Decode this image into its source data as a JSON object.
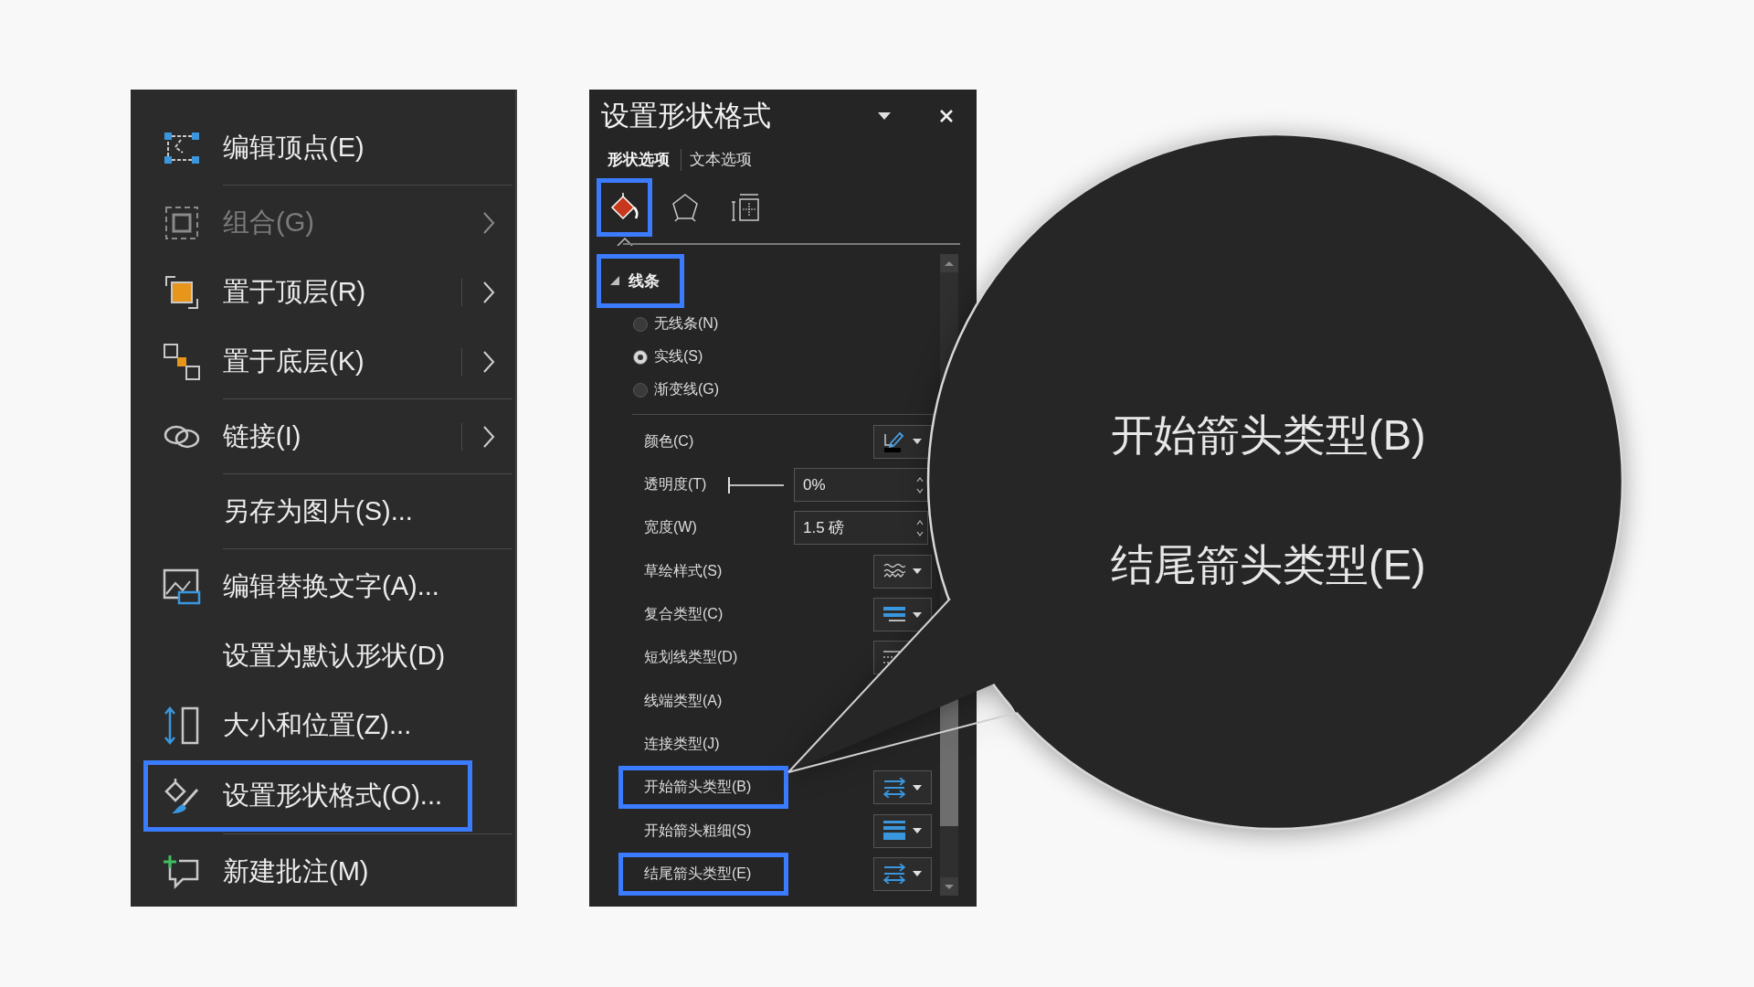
{
  "context_menu": {
    "items": [
      {
        "kind": "vertex",
        "label": "编辑顶点(E)",
        "submenu": false,
        "disabled": false,
        "highlighted": false
      },
      {
        "kind": "separator"
      },
      {
        "kind": "group",
        "label": "组合(G)",
        "submenu": true,
        "disabled": true,
        "highlighted": false
      },
      {
        "kind": "front",
        "label": "置于顶层(R)",
        "submenu": true,
        "disabled": false,
        "highlighted": false
      },
      {
        "kind": "back",
        "label": "置于底层(K)",
        "submenu": true,
        "disabled": false,
        "highlighted": false
      },
      {
        "kind": "separator"
      },
      {
        "kind": "link",
        "label": "链接(I)",
        "submenu": true,
        "disabled": false,
        "highlighted": false
      },
      {
        "kind": "separator"
      },
      {
        "kind": "plain",
        "label": "另存为图片(S)...",
        "submenu": false,
        "disabled": false,
        "highlighted": false
      },
      {
        "kind": "separator"
      },
      {
        "kind": "alt",
        "label": "编辑替换文字(A)...",
        "submenu": false,
        "disabled": false,
        "highlighted": false
      },
      {
        "kind": "plain",
        "label": "设置为默认形状(D)",
        "submenu": false,
        "disabled": false,
        "highlighted": false
      },
      {
        "kind": "size",
        "label": "大小和位置(Z)...",
        "submenu": false,
        "disabled": false,
        "highlighted": false
      },
      {
        "kind": "format",
        "label": "设置形状格式(O)...",
        "submenu": false,
        "disabled": false,
        "highlighted": true
      },
      {
        "kind": "separator"
      },
      {
        "kind": "comment",
        "label": "新建批注(M)",
        "submenu": false,
        "disabled": false,
        "highlighted": false
      }
    ]
  },
  "format_pane": {
    "title": "设置形状格式",
    "tabs": [
      {
        "label": "形状选项",
        "selected": true
      },
      {
        "label": "文本选项",
        "selected": false
      }
    ],
    "icon_tabs": [
      {
        "kind": "fill",
        "selected": true,
        "highlighted": true
      },
      {
        "kind": "effects",
        "selected": false,
        "highlighted": false
      },
      {
        "kind": "size",
        "selected": false,
        "highlighted": false
      }
    ],
    "section": {
      "title": "线条",
      "expanded": true,
      "highlighted": true
    },
    "line_options": [
      {
        "label": "无线条(N)",
        "selected": false
      },
      {
        "label": "实线(S)",
        "selected": true
      },
      {
        "label": "渐变线(G)",
        "selected": false
      }
    ],
    "rows": [
      {
        "label": "颜色(C)",
        "kind": "color",
        "highlighted": false
      },
      {
        "label": "透明度(T)",
        "kind": "slider_spin",
        "level": 0,
        "value": "0%",
        "highlighted": false
      },
      {
        "label": "宽度(W)",
        "kind": "spin",
        "value": "1.5 磅",
        "highlighted": false
      },
      {
        "label": "草绘样式(S)",
        "kind": "sketch",
        "highlighted": false
      },
      {
        "label": "复合类型(C)",
        "kind": "compound",
        "highlighted": false
      },
      {
        "label": "短划线类型(D)",
        "kind": "dash",
        "highlighted": false
      },
      {
        "label": "线端类型(A)",
        "kind": "plain",
        "highlighted": false
      },
      {
        "label": "连接类型(J)",
        "kind": "plain",
        "highlighted": false
      },
      {
        "label": "开始箭头类型(B)",
        "kind": "arrows",
        "highlighted": true
      },
      {
        "label": "开始箭头粗细(S)",
        "kind": "weight",
        "highlighted": false
      },
      {
        "label": "结尾箭头类型(E)",
        "kind": "arrows",
        "highlighted": true
      }
    ]
  },
  "magnifier": {
    "labels": [
      "开始箭头类型(B)",
      "结尾箭头类型(E)"
    ]
  }
}
